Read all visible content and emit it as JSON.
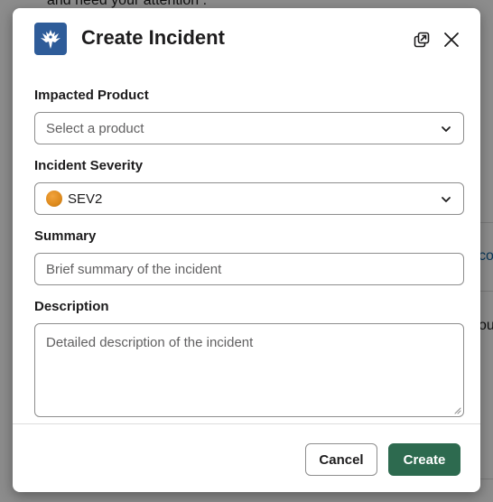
{
  "background": {
    "top_text": "and need your attention :",
    "side_link_fragment": "co",
    "side_text_fragment": "ou",
    "bottom_fragment": "/"
  },
  "modal": {
    "title": "Create Incident",
    "logo_icon": "phoenix-logo-icon",
    "popout_icon": "popout-window-icon",
    "close_icon": "close-icon"
  },
  "form": {
    "product": {
      "label": "Impacted Product",
      "placeholder": "Select a product"
    },
    "severity": {
      "label": "Incident Severity",
      "value": "SEV2",
      "indicator_color": "#e08e22"
    },
    "summary": {
      "label": "Summary",
      "placeholder": "Brief summary of the incident"
    },
    "description": {
      "label": "Description",
      "placeholder": "Detailed description of the incident"
    }
  },
  "footer": {
    "cancel_label": "Cancel",
    "create_label": "Create"
  },
  "colors": {
    "primary_button": "#2d6a4f",
    "logo_background": "#2e5c99"
  }
}
